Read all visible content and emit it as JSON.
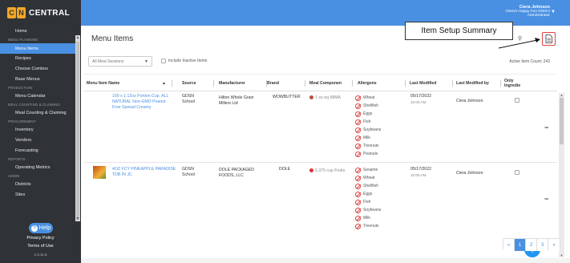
{
  "app": {
    "logo_letters": [
      "C",
      "N"
    ],
    "logo_text": "CENTRAL"
  },
  "user": {
    "name": "Ciera Johnson",
    "org": "Ciera's Happy Fun District",
    "role": "Administrator"
  },
  "sidebar": {
    "items": [
      {
        "type": "item",
        "label": "Home"
      },
      {
        "type": "section",
        "label": "MENU PLANNING"
      },
      {
        "type": "item",
        "label": "Menu Items",
        "active": true
      },
      {
        "type": "item",
        "label": "Recipes"
      },
      {
        "type": "item",
        "label": "Choose Combos"
      },
      {
        "type": "item",
        "label": "Base Menus"
      },
      {
        "type": "section",
        "label": "PRODUCTION"
      },
      {
        "type": "item",
        "label": "Menu Calendar"
      },
      {
        "type": "section",
        "label": "MEAL COUNTING & CLAIMING"
      },
      {
        "type": "item",
        "label": "Meal Counting & Claiming"
      },
      {
        "type": "section",
        "label": "PROCUREMENT"
      },
      {
        "type": "item",
        "label": "Inventory"
      },
      {
        "type": "item",
        "label": "Vendors"
      },
      {
        "type": "item",
        "label": "Forecasting"
      },
      {
        "type": "section",
        "label": "REPORTS"
      },
      {
        "type": "item",
        "label": "Operating Metrics"
      },
      {
        "type": "section",
        "label": "ADMIN"
      },
      {
        "type": "item",
        "label": "Districts"
      },
      {
        "type": "item",
        "label": "Sites"
      }
    ],
    "help_label": "Help",
    "privacy_label": "Privacy Policy",
    "terms_label": "Terms of Use",
    "version": "1.0.11.6"
  },
  "main": {
    "title": "Menu Items",
    "callout": "Item Setup Summary",
    "session_select": "All Meal Sessions",
    "include_inactive_label": "Include Inactive Items",
    "active_count": "Active Item Count: 243",
    "columns": [
      "Menu Item Name",
      "Source",
      "Manufacturer",
      "Brand",
      "Meal Componen",
      "Allergens",
      "Last Modified",
      "Last Modified by",
      "Only Ingredie"
    ],
    "rows": [
      {
        "name": "100 x 1.12oz Portion Cup, ALL NATURAL Non-GMO Peanut Free Spread Creamy",
        "source": "GDSN School",
        "manufacturer": "Hilton Whole Grain Millers Ltd",
        "brand": "WOWBUTTER",
        "meal_component": "1 oz eq M/MA",
        "meal_icon_color": "#b5533c",
        "allergens": [
          "Wheat",
          "Shellfish",
          "Eggs",
          "Fish",
          "Soybeans",
          "Milk",
          "Treenuts",
          "Peanuts"
        ],
        "last_modified_date": "05/17/2022",
        "last_modified_time": "10:05 AM",
        "modified_by": "Ciera Johnson"
      },
      {
        "name": "4OZ FCY PINEAPPLE PARADISE TDB IN JC",
        "source": "GDSN School",
        "manufacturer": "DOLE PACKAGED FOODS, LLC",
        "brand": "DOLE",
        "meal_component": "0.375 cup Fruits",
        "meal_icon_color": "#e03030",
        "allergens": [
          "Sesame",
          "Wheat",
          "Shellfish",
          "Eggs",
          "Fish",
          "Soybeans",
          "Milk",
          "Treenuts"
        ],
        "last_modified_date": "05/17/2022",
        "last_modified_time": "10:05 AM",
        "modified_by": "Ciera Johnson"
      }
    ],
    "pager": [
      "«",
      "1",
      "2",
      "3",
      "»"
    ],
    "pager_current": "1"
  },
  "colors": {
    "header": "#4a90e2",
    "sidebar": "#2f3337",
    "accent": "#4a90e2",
    "fab": "#2196f3"
  }
}
